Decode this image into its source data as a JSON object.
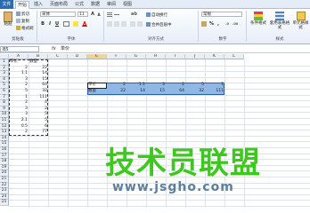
{
  "tabs": {
    "file": "文件",
    "home": "开始",
    "insert": "插入",
    "layout": "页面布局",
    "formulas": "公式",
    "data": "数据",
    "review": "审阅",
    "view": "视图"
  },
  "ribbon": {
    "paste": "粘贴",
    "cut": "剪切",
    "copy": "复制",
    "format_painter": "格式刷",
    "clipboard": "剪贴板",
    "font_name": "宋体",
    "font_size": "11",
    "bold": "B",
    "italic": "I",
    "underline": "U",
    "font_color": "A",
    "font_group": "字体",
    "wrap_text": "自动换行",
    "merge": "合并后居中",
    "alignment": "对齐方式",
    "number_format": "常规",
    "percent": "%",
    "comma": ",",
    "number": "数字",
    "cond_format": "条件格式",
    "table_format": "套用表格格式",
    "cell_style": "单元格样式",
    "styles": "样式"
  },
  "formula_bar": {
    "name_box": "B5",
    "fx": "fx",
    "value": "单价"
  },
  "columns": [
    "A",
    "B",
    "C",
    "D",
    "E",
    "F",
    "G",
    "H",
    "I",
    "J",
    "K",
    "L"
  ],
  "rows": [
    "1",
    "2",
    "3",
    "4",
    "5",
    "6",
    "7",
    "8",
    "9",
    "10",
    "11",
    "12",
    "13",
    "14",
    "15",
    "16",
    "17",
    "18",
    "19",
    "20",
    "21",
    "22",
    "23",
    "24",
    "25"
  ],
  "left_table": {
    "headers": [
      "单价",
      "数量"
    ],
    "rows": [
      [
        "2",
        "22"
      ],
      [
        "1.1",
        "14"
      ],
      [
        "3",
        "15"
      ],
      [
        "2",
        "64"
      ],
      [
        "5",
        "32"
      ],
      [
        "1",
        "111"
      ],
      [
        "2",
        "4"
      ],
      [
        "3",
        "2"
      ],
      [
        "3",
        "5"
      ],
      [
        "2.1",
        "5"
      ],
      [
        "0.5",
        "6"
      ],
      [
        "2",
        "77"
      ]
    ]
  },
  "right_table": {
    "labels": [
      "单价",
      "数量"
    ],
    "row1": [
      "2",
      "1.1",
      "3",
      "2",
      "5",
      "1"
    ],
    "row2": [
      "22",
      "14",
      "15",
      "64",
      "32",
      "111"
    ]
  },
  "watermark": {
    "title": "技术员联盟",
    "url": "www.jsgho.com"
  },
  "colors": {
    "accent": "#2a6ab3",
    "selection": "#8fb8e6",
    "watermark_green": "#3ec71e"
  }
}
